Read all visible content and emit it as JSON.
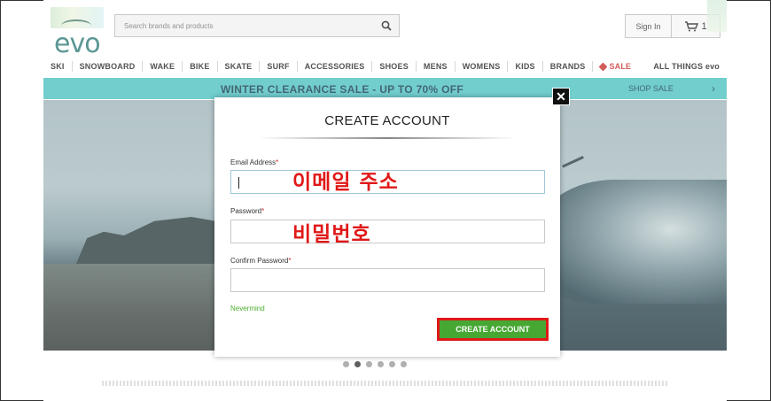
{
  "header": {
    "logo_text": "evo",
    "search_placeholder": "Search brands and products",
    "sign_in": "Sign In",
    "cart_count": "1"
  },
  "nav": {
    "items": [
      "SKI",
      "SNOWBOARD",
      "WAKE",
      "BIKE",
      "SKATE",
      "SURF",
      "ACCESSORIES",
      "SHOES",
      "MENS",
      "WOMENS",
      "KIDS",
      "BRANDS"
    ],
    "sale": "SALE",
    "all_things": "ALL THINGS evo"
  },
  "banner": {
    "text": "WINTER CLEARANCE SALE - UP TO 70% OFF",
    "shop": "SHOP SALE",
    "chevron": "›"
  },
  "carousel": {
    "slide_count": 6,
    "active_index": 1
  },
  "modal": {
    "close": "✕",
    "title": "CREATE ACCOUNT",
    "email_label": "Email Address",
    "password_label": "Password",
    "confirm_label": "Confirm Password",
    "required_mark": "*",
    "email_value": "",
    "password_value": "",
    "confirm_value": "",
    "nevermind": "Nevermind",
    "create_button": "CREATE ACCOUNT"
  },
  "annotations": {
    "email_note": "이메일 주소",
    "password_note": "비밀번호",
    "highlight_color": "#e01818"
  },
  "colors": {
    "banner": "#4bbfbf",
    "button": "#46a833",
    "sale": "#c5302b"
  },
  "icons": {
    "search": "search-icon",
    "cart": "cart-icon",
    "close": "close-icon",
    "tag": "tag-icon"
  }
}
